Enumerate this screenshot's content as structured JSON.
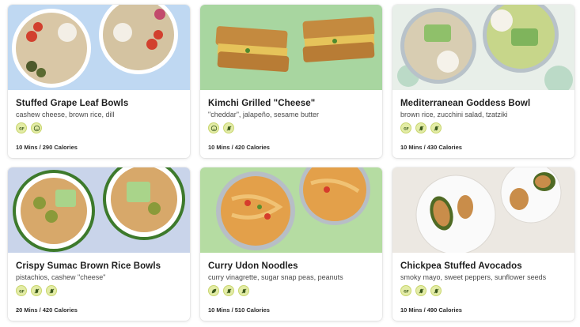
{
  "recipes": [
    {
      "title": "Stuffed Grape Leaf Bowls",
      "subtitle": "cashew cheese, brown rice, dill",
      "tags": [
        "gluten-free-icon",
        "smile-icon"
      ],
      "meta": "10 Mins / 290 Calories",
      "photo_bg": "#bfd8f2"
    },
    {
      "title": "Kimchi Grilled \"Cheese\"",
      "subtitle": "\"cheddar\", jalapeño, sesame butter",
      "tags": [
        "smile-icon",
        "no-nut-icon"
      ],
      "meta": "10 Mins / 420 Calories",
      "photo_bg": "#a8d6a0"
    },
    {
      "title": "Mediterranean Goddess Bowl",
      "subtitle": "brown rice, zucchini salad, tzatziki",
      "tags": [
        "gluten-free-icon",
        "no-nut-icon",
        "no-nut-icon"
      ],
      "meta": "10 Mins / 430 Calories",
      "photo_bg": "#e8efe9"
    },
    {
      "title": "Crispy Sumac Brown Rice Bowls",
      "subtitle": "pistachios, cashew \"cheese\"",
      "tags": [
        "gluten-free-icon",
        "no-nut-icon",
        "no-nut-icon"
      ],
      "meta": "20 Mins / 420 Calories",
      "photo_bg": "#c9d4ea"
    },
    {
      "title": "Curry Udon Noodles",
      "subtitle": "curry vinagrette, sugar snap peas, peanuts",
      "tags": [
        "leaf-icon",
        "no-nut-icon",
        "no-nut-icon"
      ],
      "meta": "10 Mins / 510 Calories",
      "photo_bg": "#b5dca2"
    },
    {
      "title": "Chickpea Stuffed Avocados",
      "subtitle": "smoky mayo, sweet peppers, sunflower seeds",
      "tags": [
        "gluten-free-icon",
        "no-nut-icon",
        "no-nut-icon"
      ],
      "meta": "10 Mins / 490 Calories",
      "photo_bg": "#ece8e2"
    }
  ],
  "colors": {
    "tag_fill": "#e3eca6",
    "tag_icon": "#3c5a1e"
  }
}
